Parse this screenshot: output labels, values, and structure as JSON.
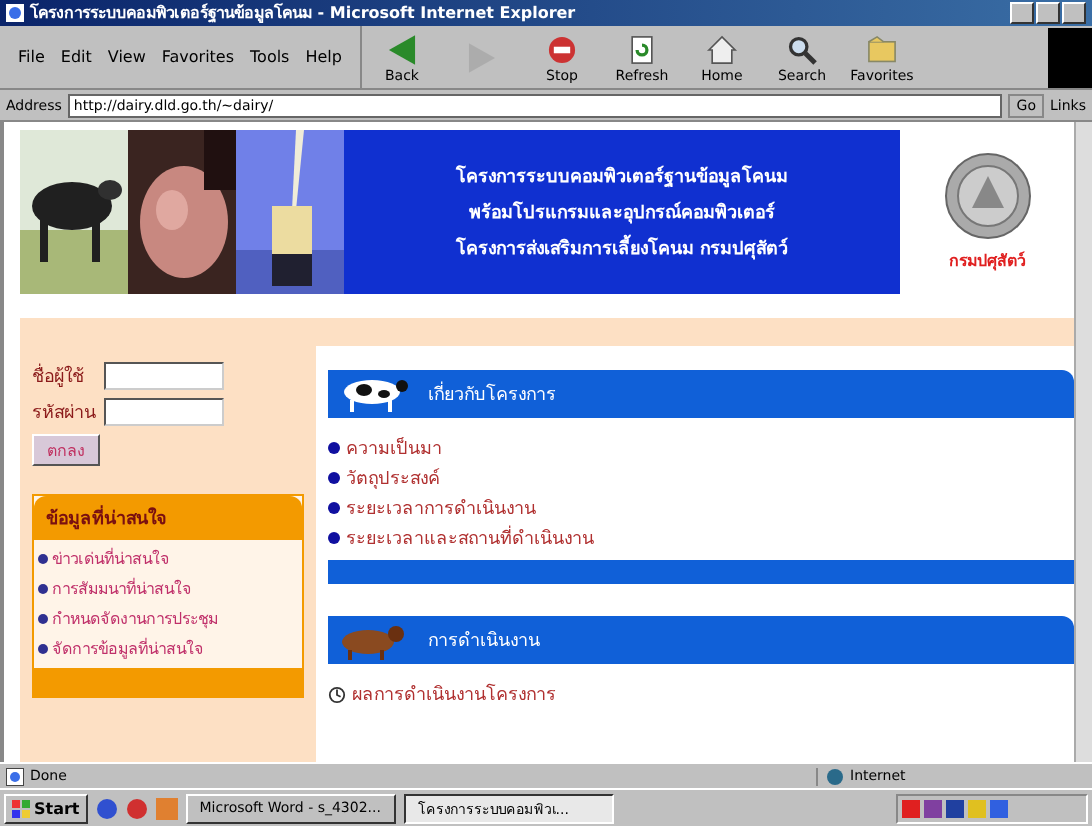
{
  "window": {
    "title": "โครงการระบบคอมพิวเตอร์ฐานข้อมูลโคนม - Microsoft Internet Explorer"
  },
  "menu": [
    "File",
    "Edit",
    "View",
    "Favorites",
    "Tools",
    "Help"
  ],
  "toolbar": [
    {
      "kind": "back",
      "label": "Back",
      "disabled": false
    },
    {
      "kind": "forward",
      "disabled": true
    },
    {
      "kind": "stop",
      "label": "Stop",
      "disabled": false
    },
    {
      "kind": "refresh",
      "label": "Refresh",
      "disabled": false
    },
    {
      "kind": "home",
      "label": "Home",
      "disabled": false
    },
    {
      "kind": "search",
      "label": "Search",
      "disabled": false
    },
    {
      "kind": "favorites",
      "label": "Favorites",
      "disabled": false
    }
  ],
  "address": {
    "label": "Address",
    "value": "http://dairy.dld.go.th/~dairy/",
    "go": "Go",
    "links": "Links"
  },
  "banner": {
    "lines": [
      "โครงการระบบคอมพิวเตอร์ฐานข้อมูลโคนม",
      "พร้อมโปรแกรมและอุปกรณ์คอมพิวเตอร์",
      "โครงการส่งเสริมการเลี้ยงโคนม กรมปศุสัตว์"
    ],
    "logo_caption": "กรมปศุสัตว์"
  },
  "login": {
    "user_label": "ชื่อผู้ใช้",
    "password_label": "รหัสผ่าน",
    "button": "ตกลง"
  },
  "side_box": {
    "title": "ข้อมูลที่น่าสนใจ",
    "items": [
      "ข่าวเด่นที่น่าสนใจ",
      "การสัมมนาที่น่าสนใจ",
      "กำหนดจัดงานการประชุม",
      "จัดการข้อมูลที่น่าสนใจ"
    ]
  },
  "sections": [
    {
      "title": "เกี่ยวกับโครงการ",
      "kind": "bulleted",
      "items": [
        "ความเป็นมา",
        "วัตถุประสงค์",
        "ระยะเวลาการดำเนินงาน",
        "ระยะเวลาและสถานที่ดำเนินงาน"
      ]
    },
    {
      "title": "การดำเนินงาน",
      "kind": "timed",
      "items": [
        "ผลการดำเนินงานโครงการ"
      ]
    }
  ],
  "status_bar": {
    "text": "Done",
    "zone": "Internet"
  },
  "taskbar": {
    "start": "Start",
    "tasks": [
      {
        "label": "Microsoft Word - s_4302...",
        "selected": false
      },
      {
        "label": "โครงการระบบคอมพิวเ...",
        "selected": true
      }
    ]
  }
}
